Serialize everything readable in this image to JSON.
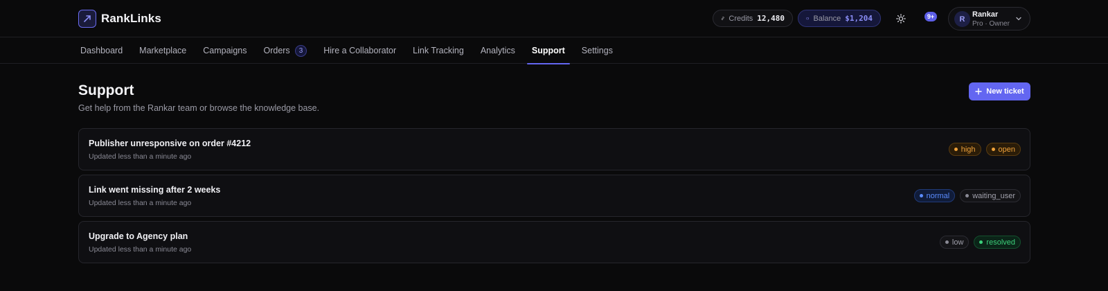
{
  "app": {
    "name": "RankLinks"
  },
  "header": {
    "credits_label": "Credits",
    "credits_value": "12,480",
    "balance_label": "Balance",
    "balance_value": "$1,204",
    "notifications_badge": "9+",
    "user": {
      "initial": "R",
      "name": "Rankar",
      "role": "Pro · Owner"
    }
  },
  "nav": {
    "items": [
      {
        "label": "Dashboard"
      },
      {
        "label": "Marketplace"
      },
      {
        "label": "Campaigns"
      },
      {
        "label": "Orders",
        "badge": "3"
      },
      {
        "label": "Hire a Collaborator"
      },
      {
        "label": "Link Tracking"
      },
      {
        "label": "Analytics"
      },
      {
        "label": "Support",
        "active": true
      },
      {
        "label": "Settings"
      }
    ]
  },
  "page": {
    "title": "Support",
    "subtitle": "Get help from the Rankar team or browse the knowledge base.",
    "new_ticket_label": "New ticket"
  },
  "tickets": [
    {
      "title": "Publisher unresponsive on order #4212",
      "updated": "Updated less than a minute ago",
      "priority": "high",
      "status": "open"
    },
    {
      "title": "Link went missing after 2 weeks",
      "updated": "Updated less than a minute ago",
      "priority": "normal",
      "status": "waiting_user"
    },
    {
      "title": "Upgrade to Agency plan",
      "updated": "Updated less than a minute ago",
      "priority": "low",
      "status": "resolved"
    }
  ],
  "colors": {
    "accent": "#6366f1",
    "high": "#f0a23a",
    "normal": "#5b8cff",
    "neutral": "#a2a2ad",
    "resolved": "#3ccf7a"
  }
}
